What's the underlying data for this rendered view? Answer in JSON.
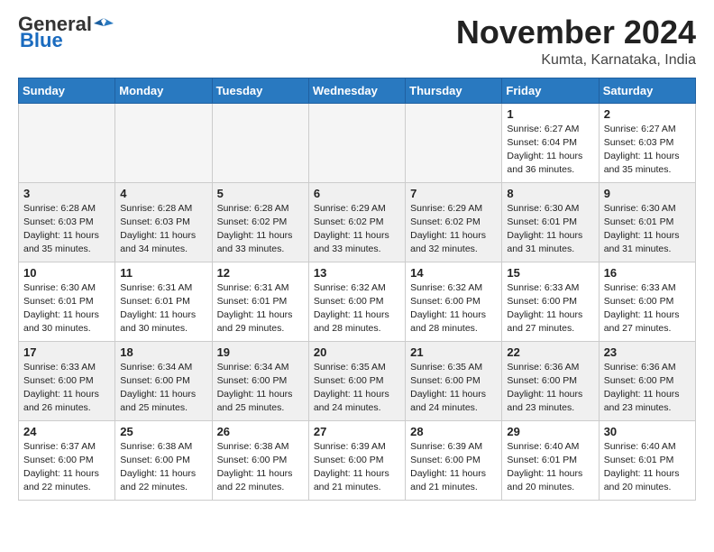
{
  "header": {
    "logo_general": "General",
    "logo_blue": "Blue",
    "title": "November 2024",
    "subtitle": "Kumta, Karnataka, India"
  },
  "weekdays": [
    "Sunday",
    "Monday",
    "Tuesday",
    "Wednesday",
    "Thursday",
    "Friday",
    "Saturday"
  ],
  "weeks": [
    [
      {
        "day": "",
        "info": "",
        "empty": true
      },
      {
        "day": "",
        "info": "",
        "empty": true
      },
      {
        "day": "",
        "info": "",
        "empty": true
      },
      {
        "day": "",
        "info": "",
        "empty": true
      },
      {
        "day": "",
        "info": "",
        "empty": true
      },
      {
        "day": "1",
        "info": "Sunrise: 6:27 AM\nSunset: 6:04 PM\nDaylight: 11 hours\nand 36 minutes.",
        "empty": false
      },
      {
        "day": "2",
        "info": "Sunrise: 6:27 AM\nSunset: 6:03 PM\nDaylight: 11 hours\nand 35 minutes.",
        "empty": false
      }
    ],
    [
      {
        "day": "3",
        "info": "Sunrise: 6:28 AM\nSunset: 6:03 PM\nDaylight: 11 hours\nand 35 minutes.",
        "empty": false
      },
      {
        "day": "4",
        "info": "Sunrise: 6:28 AM\nSunset: 6:03 PM\nDaylight: 11 hours\nand 34 minutes.",
        "empty": false
      },
      {
        "day": "5",
        "info": "Sunrise: 6:28 AM\nSunset: 6:02 PM\nDaylight: 11 hours\nand 33 minutes.",
        "empty": false
      },
      {
        "day": "6",
        "info": "Sunrise: 6:29 AM\nSunset: 6:02 PM\nDaylight: 11 hours\nand 33 minutes.",
        "empty": false
      },
      {
        "day": "7",
        "info": "Sunrise: 6:29 AM\nSunset: 6:02 PM\nDaylight: 11 hours\nand 32 minutes.",
        "empty": false
      },
      {
        "day": "8",
        "info": "Sunrise: 6:30 AM\nSunset: 6:01 PM\nDaylight: 11 hours\nand 31 minutes.",
        "empty": false
      },
      {
        "day": "9",
        "info": "Sunrise: 6:30 AM\nSunset: 6:01 PM\nDaylight: 11 hours\nand 31 minutes.",
        "empty": false
      }
    ],
    [
      {
        "day": "10",
        "info": "Sunrise: 6:30 AM\nSunset: 6:01 PM\nDaylight: 11 hours\nand 30 minutes.",
        "empty": false
      },
      {
        "day": "11",
        "info": "Sunrise: 6:31 AM\nSunset: 6:01 PM\nDaylight: 11 hours\nand 30 minutes.",
        "empty": false
      },
      {
        "day": "12",
        "info": "Sunrise: 6:31 AM\nSunset: 6:01 PM\nDaylight: 11 hours\nand 29 minutes.",
        "empty": false
      },
      {
        "day": "13",
        "info": "Sunrise: 6:32 AM\nSunset: 6:00 PM\nDaylight: 11 hours\nand 28 minutes.",
        "empty": false
      },
      {
        "day": "14",
        "info": "Sunrise: 6:32 AM\nSunset: 6:00 PM\nDaylight: 11 hours\nand 28 minutes.",
        "empty": false
      },
      {
        "day": "15",
        "info": "Sunrise: 6:33 AM\nSunset: 6:00 PM\nDaylight: 11 hours\nand 27 minutes.",
        "empty": false
      },
      {
        "day": "16",
        "info": "Sunrise: 6:33 AM\nSunset: 6:00 PM\nDaylight: 11 hours\nand 27 minutes.",
        "empty": false
      }
    ],
    [
      {
        "day": "17",
        "info": "Sunrise: 6:33 AM\nSunset: 6:00 PM\nDaylight: 11 hours\nand 26 minutes.",
        "empty": false
      },
      {
        "day": "18",
        "info": "Sunrise: 6:34 AM\nSunset: 6:00 PM\nDaylight: 11 hours\nand 25 minutes.",
        "empty": false
      },
      {
        "day": "19",
        "info": "Sunrise: 6:34 AM\nSunset: 6:00 PM\nDaylight: 11 hours\nand 25 minutes.",
        "empty": false
      },
      {
        "day": "20",
        "info": "Sunrise: 6:35 AM\nSunset: 6:00 PM\nDaylight: 11 hours\nand 24 minutes.",
        "empty": false
      },
      {
        "day": "21",
        "info": "Sunrise: 6:35 AM\nSunset: 6:00 PM\nDaylight: 11 hours\nand 24 minutes.",
        "empty": false
      },
      {
        "day": "22",
        "info": "Sunrise: 6:36 AM\nSunset: 6:00 PM\nDaylight: 11 hours\nand 23 minutes.",
        "empty": false
      },
      {
        "day": "23",
        "info": "Sunrise: 6:36 AM\nSunset: 6:00 PM\nDaylight: 11 hours\nand 23 minutes.",
        "empty": false
      }
    ],
    [
      {
        "day": "24",
        "info": "Sunrise: 6:37 AM\nSunset: 6:00 PM\nDaylight: 11 hours\nand 22 minutes.",
        "empty": false
      },
      {
        "day": "25",
        "info": "Sunrise: 6:38 AM\nSunset: 6:00 PM\nDaylight: 11 hours\nand 22 minutes.",
        "empty": false
      },
      {
        "day": "26",
        "info": "Sunrise: 6:38 AM\nSunset: 6:00 PM\nDaylight: 11 hours\nand 22 minutes.",
        "empty": false
      },
      {
        "day": "27",
        "info": "Sunrise: 6:39 AM\nSunset: 6:00 PM\nDaylight: 11 hours\nand 21 minutes.",
        "empty": false
      },
      {
        "day": "28",
        "info": "Sunrise: 6:39 AM\nSunset: 6:00 PM\nDaylight: 11 hours\nand 21 minutes.",
        "empty": false
      },
      {
        "day": "29",
        "info": "Sunrise: 6:40 AM\nSunset: 6:01 PM\nDaylight: 11 hours\nand 20 minutes.",
        "empty": false
      },
      {
        "day": "30",
        "info": "Sunrise: 6:40 AM\nSunset: 6:01 PM\nDaylight: 11 hours\nand 20 minutes.",
        "empty": false
      }
    ]
  ]
}
